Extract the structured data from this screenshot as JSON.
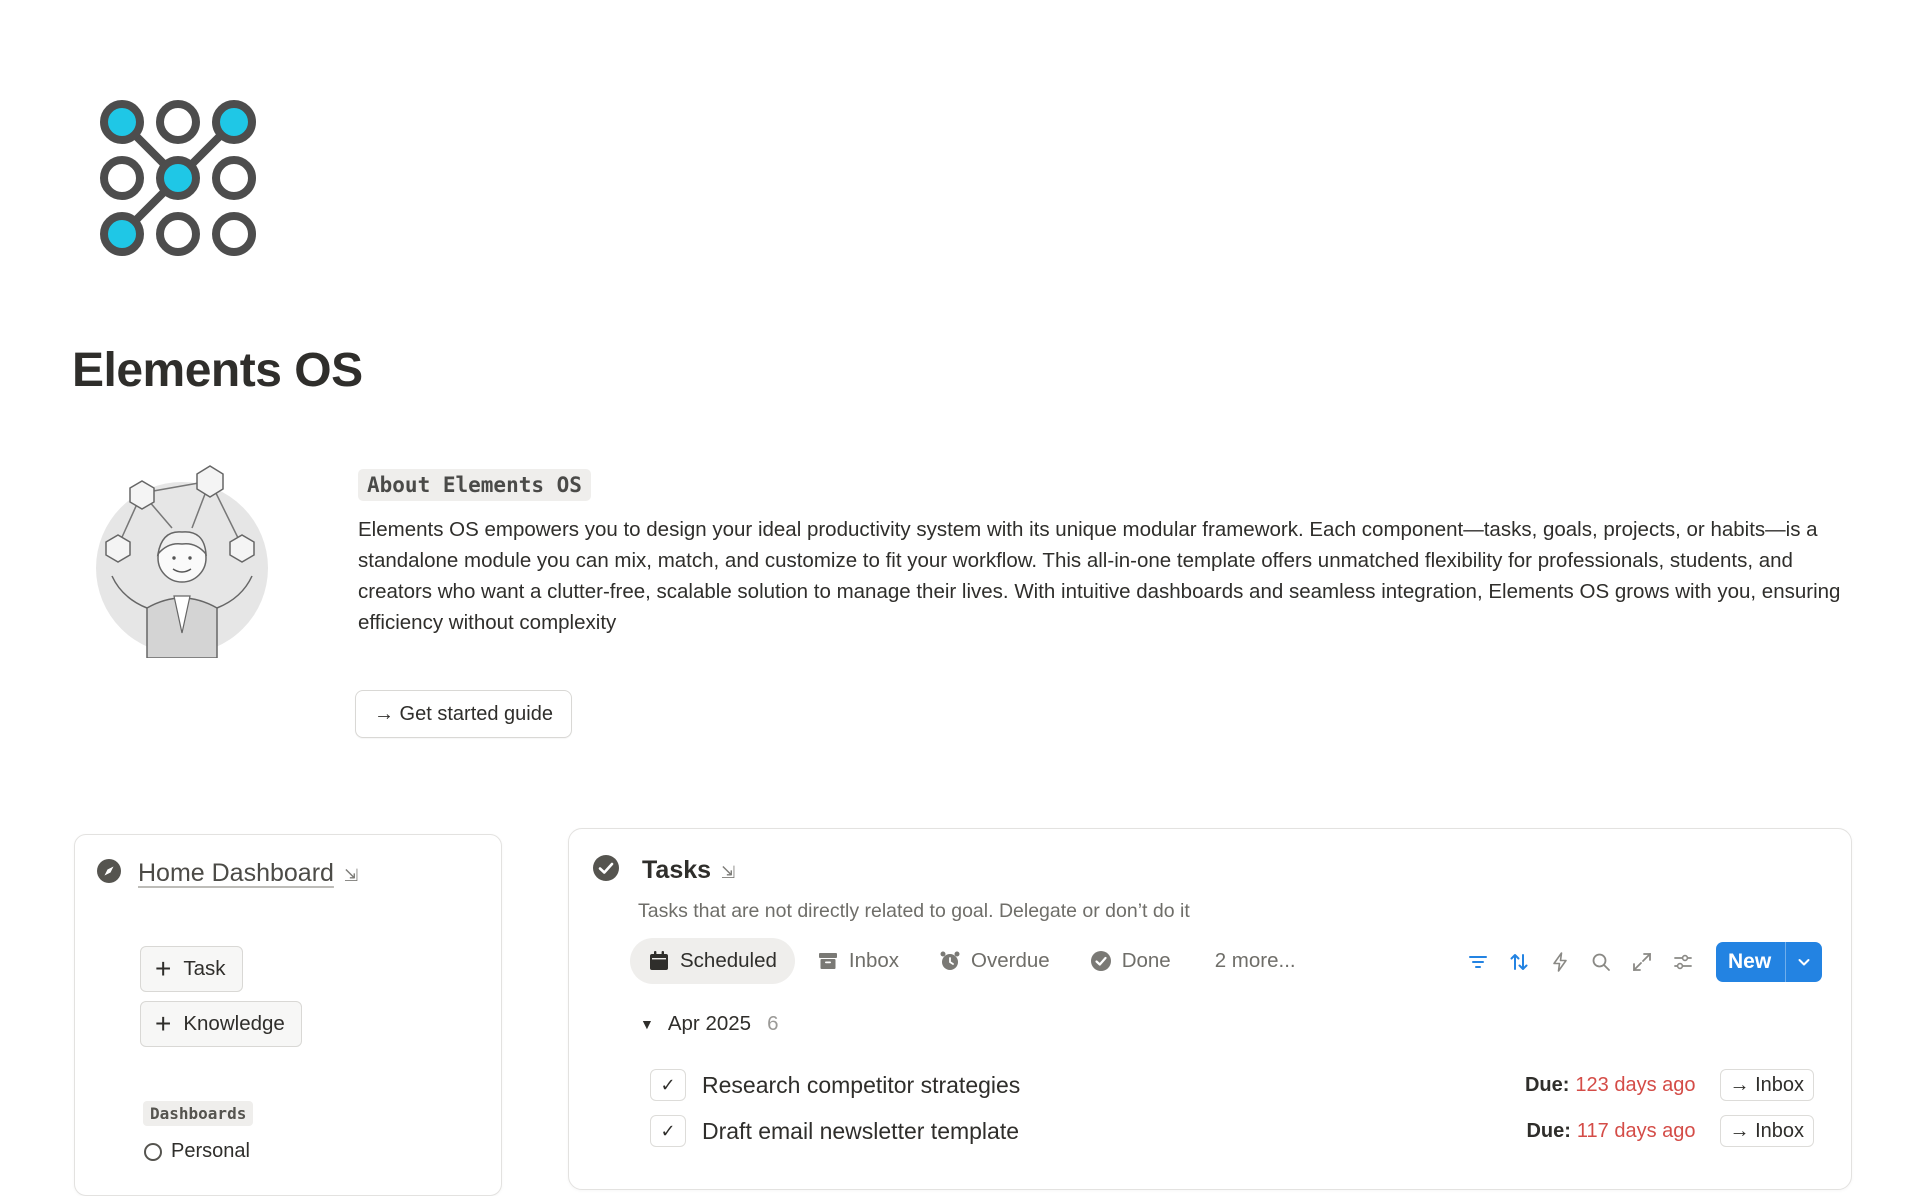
{
  "page": {
    "title": "Elements OS"
  },
  "about": {
    "heading": "About Elements OS",
    "body": "Elements OS empowers you to design your ideal productivity system with its unique modular framework. Each component—tasks, goals, projects, or habits—is a standalone module you can mix, match, and customize to fit your workflow. This all-in-one template offers unmatched flexibility for professionals, students, and creators who want a clutter-free, scalable solution to manage their lives. With intuitive dashboards and seamless integration, Elements OS grows with you, ensuring efficiency without complexity",
    "button_label": "→ Get started guide"
  },
  "home": {
    "title": "Home Dashboard",
    "link_arrow": "⇲",
    "add_task_label": "Task",
    "add_knowledge_label": "Knowledge",
    "dashboards_label": "Dashboards",
    "first_item": "Personal"
  },
  "tasks": {
    "title": "Tasks",
    "link_arrow": "⇲",
    "description": "Tasks that are not directly related to goal. Delegate or don’t do it",
    "tabs": [
      {
        "label": "Scheduled",
        "icon": "calendar-icon",
        "active": true
      },
      {
        "label": "Inbox",
        "icon": "archive-icon",
        "active": false
      },
      {
        "label": "Overdue",
        "icon": "alarm-clock-icon",
        "active": false
      },
      {
        "label": "Done",
        "icon": "check-circle-icon",
        "active": false
      },
      {
        "label": "2 more...",
        "icon": "",
        "active": false
      }
    ],
    "toolbar_icons": [
      "filter-icon",
      "sort-icon",
      "automation-icon",
      "search-icon",
      "expand-icon",
      "settings-icon"
    ],
    "new_label": "New",
    "group": {
      "label": "Apr 2025",
      "count": "6"
    },
    "rows": [
      {
        "name": "Research competitor strategies",
        "checked": "✓",
        "due_label": "Due:",
        "due_value": "123 days ago",
        "action": "→ Inbox"
      },
      {
        "name": "Draft email newsletter template",
        "checked": "✓",
        "due_label": "Due:",
        "due_value": "117 days ago",
        "action": "→ Inbox"
      }
    ]
  },
  "colors": {
    "accent_cyan": "#1fc7e6",
    "logo_gray": "#4d4d4d",
    "primary_blue": "#2383e2",
    "overdue_red": "#d44c47"
  }
}
